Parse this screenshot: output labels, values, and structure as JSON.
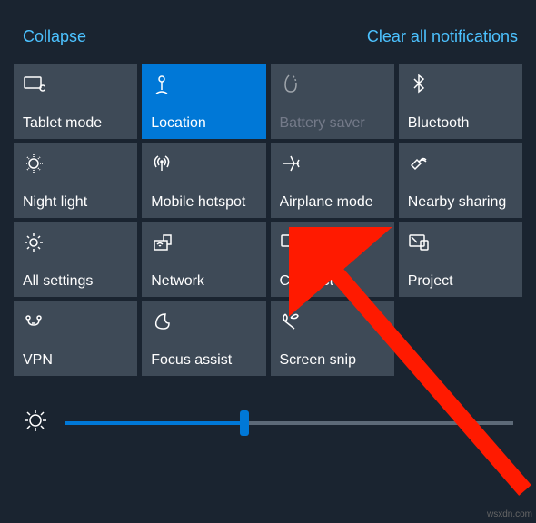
{
  "header": {
    "collapse": "Collapse",
    "clear": "Clear all notifications"
  },
  "tiles": [
    {
      "id": "tablet-mode",
      "label": "Tablet mode",
      "icon": "tablet",
      "state": "off"
    },
    {
      "id": "location",
      "label": "Location",
      "icon": "location",
      "state": "on"
    },
    {
      "id": "battery-saver",
      "label": "Battery saver",
      "icon": "battery",
      "state": "disabled"
    },
    {
      "id": "bluetooth",
      "label": "Bluetooth",
      "icon": "bluetooth",
      "state": "off"
    },
    {
      "id": "night-light",
      "label": "Night light",
      "icon": "night-light",
      "state": "off"
    },
    {
      "id": "mobile-hotspot",
      "label": "Mobile hotspot",
      "icon": "hotspot",
      "state": "off"
    },
    {
      "id": "airplane-mode",
      "label": "Airplane mode",
      "icon": "airplane",
      "state": "off"
    },
    {
      "id": "nearby-sharing",
      "label": "Nearby sharing",
      "icon": "nearby",
      "state": "off"
    },
    {
      "id": "all-settings",
      "label": "All settings",
      "icon": "settings",
      "state": "off"
    },
    {
      "id": "network",
      "label": "Network",
      "icon": "network",
      "state": "off"
    },
    {
      "id": "connect",
      "label": "Connect",
      "icon": "connect",
      "state": "off"
    },
    {
      "id": "project",
      "label": "Project",
      "icon": "project",
      "state": "off"
    },
    {
      "id": "vpn",
      "label": "VPN",
      "icon": "vpn",
      "state": "off"
    },
    {
      "id": "focus-assist",
      "label": "Focus assist",
      "icon": "focus",
      "state": "off"
    },
    {
      "id": "screen-snip",
      "label": "Screen snip",
      "icon": "snip",
      "state": "off"
    }
  ],
  "brightness": {
    "value": 40
  },
  "watermark": "wsxdn.com",
  "annotation": {
    "arrow_target": "airplane-mode"
  }
}
